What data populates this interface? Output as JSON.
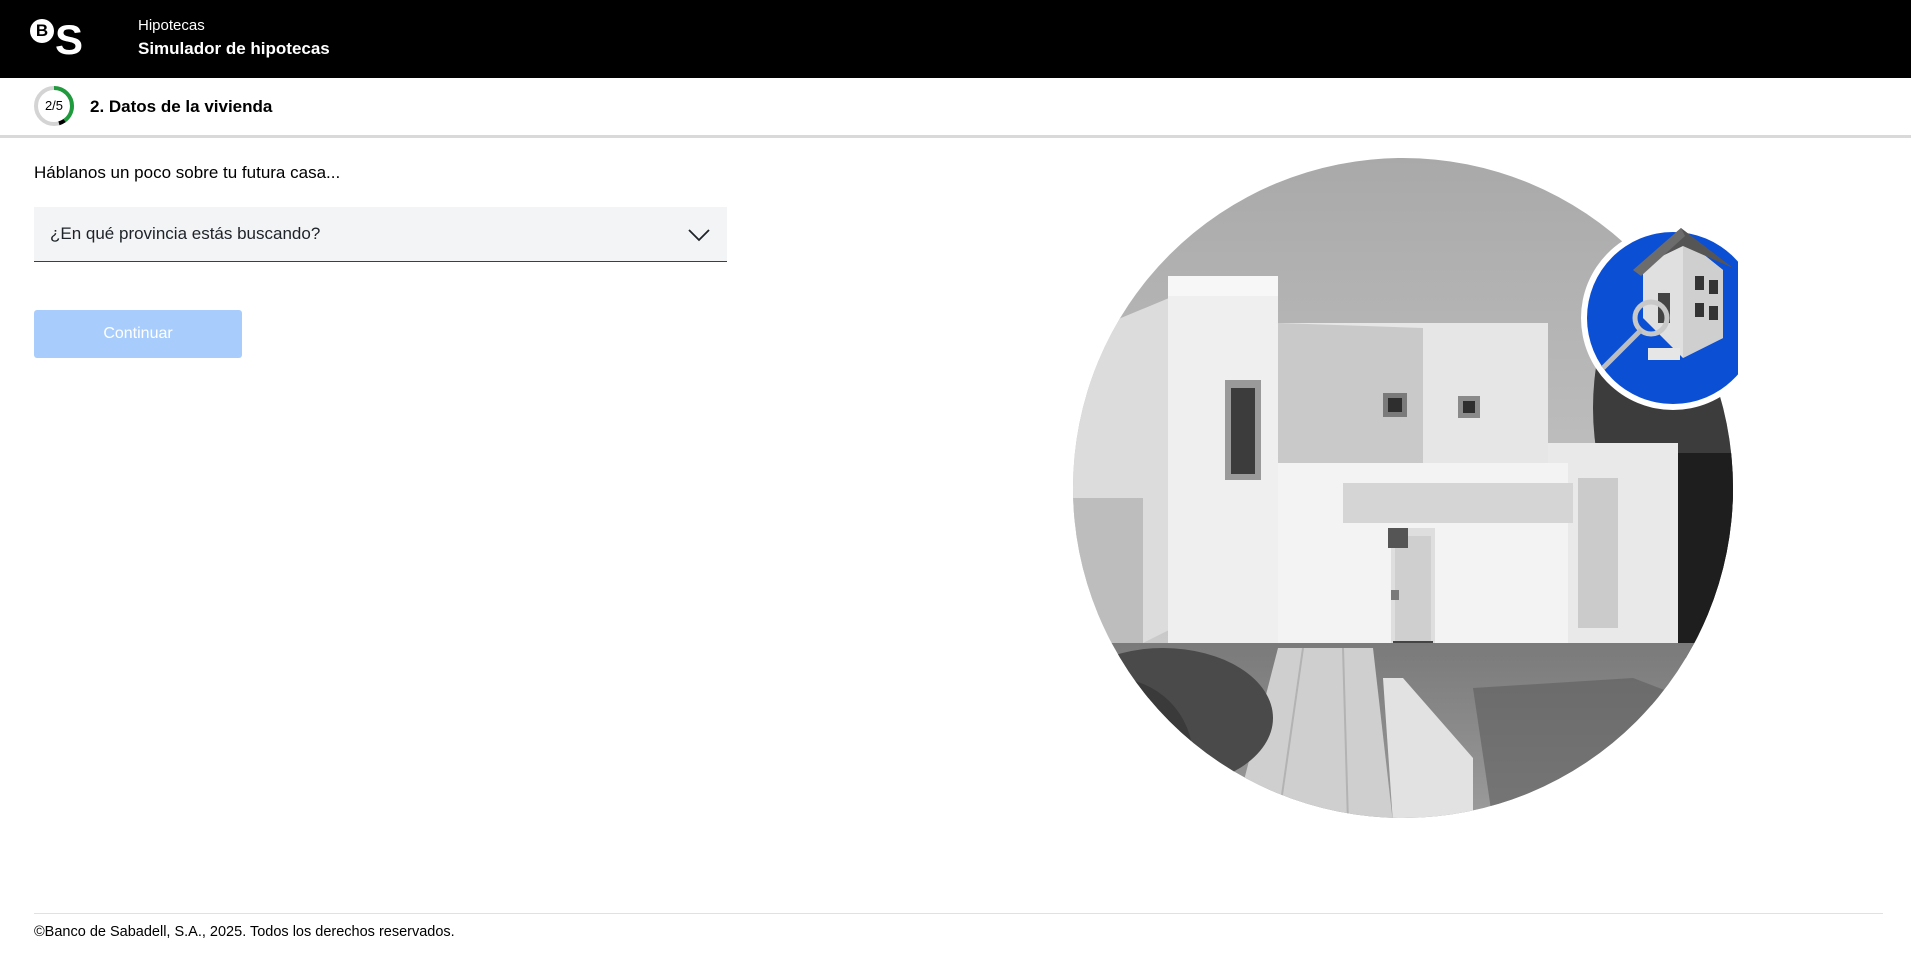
{
  "header": {
    "logo_mark_b": "B",
    "logo_mark_s": "S",
    "section": "Hipotecas",
    "title": "Simulador de hipotecas"
  },
  "step": {
    "counter": "2/5",
    "progress_fraction": 0.4,
    "title": "2. Datos de la vivienda"
  },
  "form": {
    "intro": "Háblanos un poco sobre tu futura casa...",
    "province_placeholder": "¿En qué provincia estás buscando?",
    "continue_label": "Continuar"
  },
  "footer": {
    "copyright": "©Banco de Sabadell, S.A., 2025. Todos los derechos reservados."
  },
  "colors": {
    "header_bg": "#000000",
    "progress_green": "#1f9a3c",
    "button_disabled": "#a8cdfc",
    "badge_blue": "#0b4fd4",
    "field_bg": "#f3f4f5"
  },
  "icons": {
    "logo": "bs-logo-icon",
    "select": "chevron-down-icon",
    "badge": "house-with-keys-icon"
  }
}
